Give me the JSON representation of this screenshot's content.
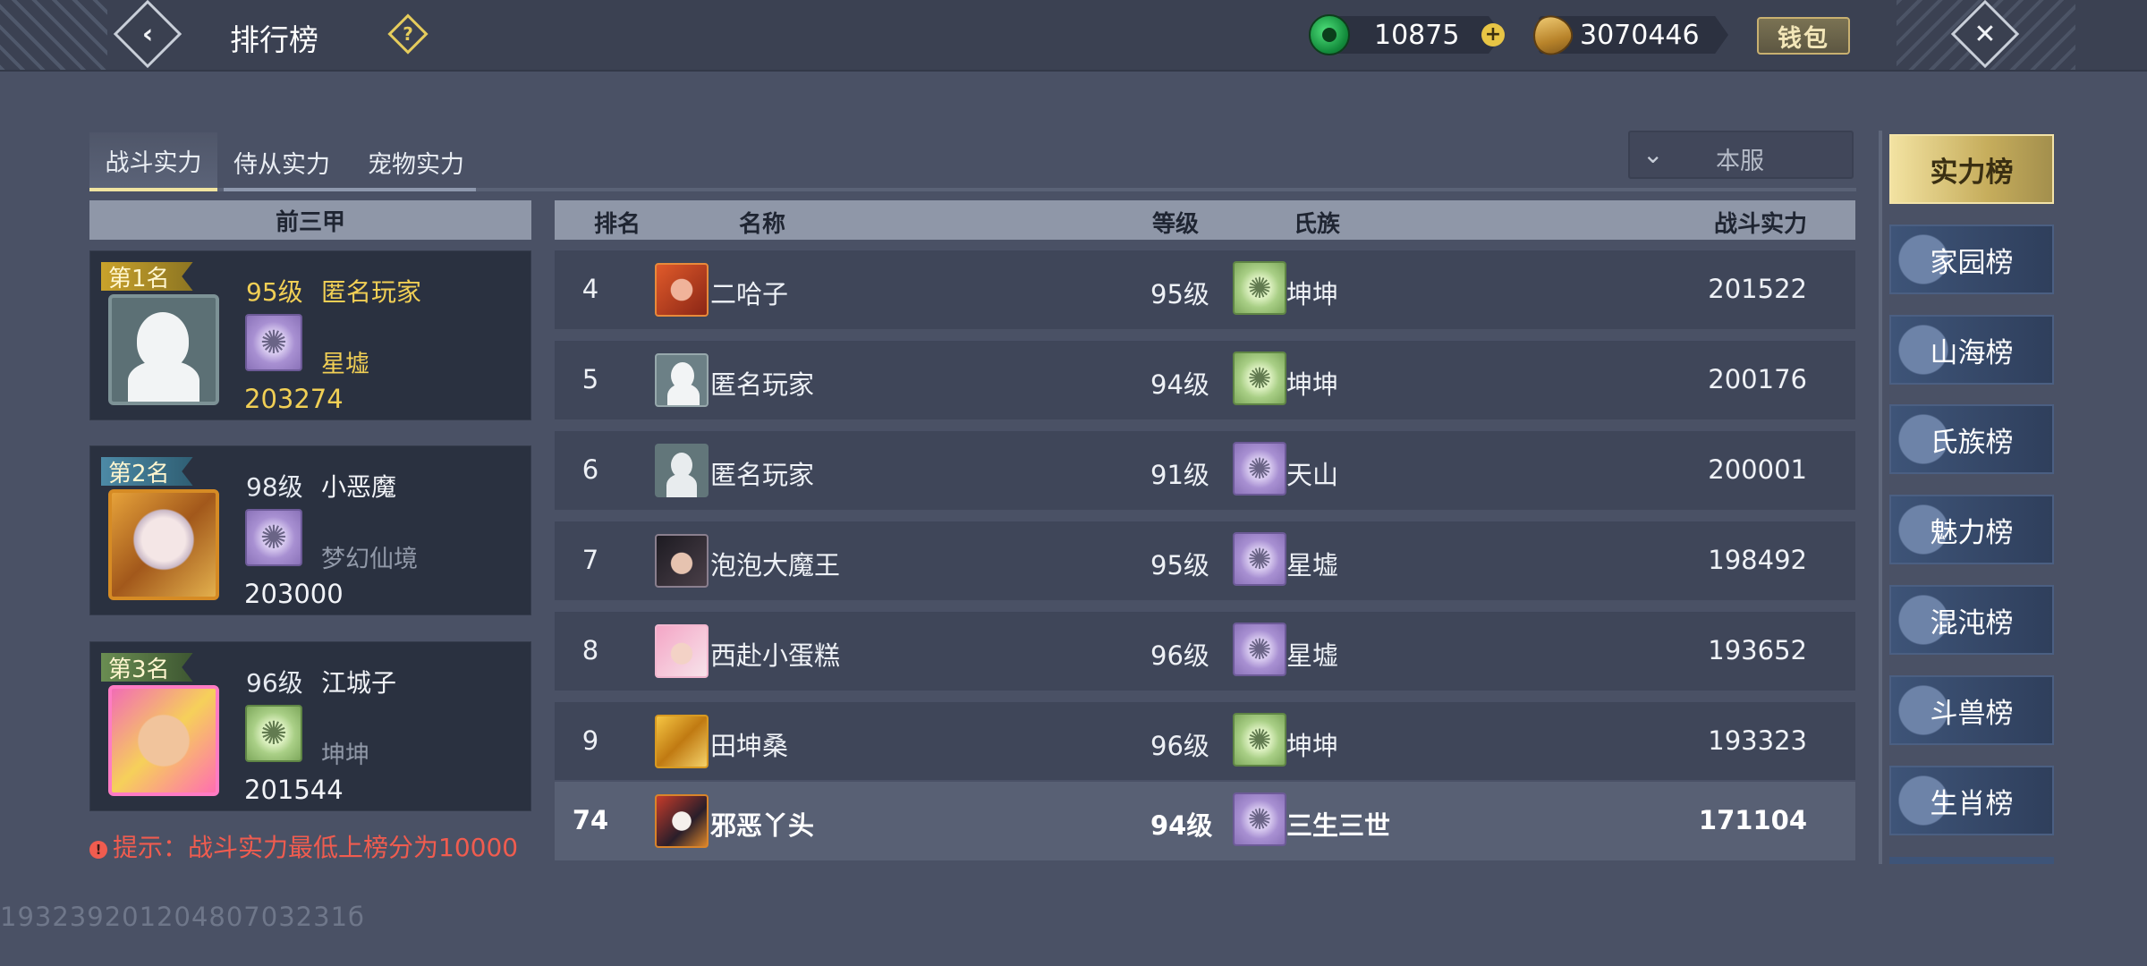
{
  "header": {
    "title": "排行榜",
    "back_icon": "chevron-left-icon",
    "help_icon": "question-icon",
    "close_icon": "close-icon",
    "jade_amount": "10875",
    "gold_amount": "3070446",
    "wallet_label": "钱包"
  },
  "tabs": [
    {
      "label": "战斗实力",
      "active": true
    },
    {
      "label": "侍从实力",
      "active": false
    },
    {
      "label": "宠物实力",
      "active": false
    }
  ],
  "server_select": {
    "value": "本服"
  },
  "top3": {
    "header": "前三甲",
    "entries": [
      {
        "rank_label": "第1名",
        "level": "95级",
        "name": "匿名玩家",
        "clan": "星墟",
        "power": "203274"
      },
      {
        "rank_label": "第2名",
        "level": "98级",
        "name": "小恶魔",
        "clan": "梦幻仙境",
        "power": "203000"
      },
      {
        "rank_label": "第3名",
        "level": "96级",
        "name": "江城子",
        "clan": "坤坤",
        "power": "201544"
      }
    ],
    "hint": "提示：战斗实力最低上榜分为10000"
  },
  "table": {
    "columns": {
      "rank": "排名",
      "name": "名称",
      "level": "等级",
      "clan": "氏族",
      "power": "战斗实力"
    },
    "rows": [
      {
        "rank": "4",
        "name": "二哈子",
        "level": "95级",
        "clan": "坤坤",
        "power": "201522"
      },
      {
        "rank": "5",
        "name": "匿名玩家",
        "level": "94级",
        "clan": "坤坤",
        "power": "200176"
      },
      {
        "rank": "6",
        "name": "匿名玩家",
        "level": "91级",
        "clan": "天山",
        "power": "200001"
      },
      {
        "rank": "7",
        "name": "泡泡大魔王",
        "level": "95级",
        "clan": "星墟",
        "power": "198492"
      },
      {
        "rank": "8",
        "name": "西赴小蛋糕",
        "level": "96级",
        "clan": "星墟",
        "power": "193652"
      },
      {
        "rank": "9",
        "name": "田坤桑",
        "level": "96级",
        "clan": "坤坤",
        "power": "193323"
      }
    ],
    "self_row": {
      "rank": "74",
      "name": "邪恶丫头",
      "level": "94级",
      "clan": "三生三世",
      "power": "171104"
    }
  },
  "boards": [
    {
      "label": "实力榜",
      "active": true
    },
    {
      "label": "家园榜",
      "active": false
    },
    {
      "label": "山海榜",
      "active": false
    },
    {
      "label": "氏族榜",
      "active": false
    },
    {
      "label": "魅力榜",
      "active": false
    },
    {
      "label": "混沌榜",
      "active": false
    },
    {
      "label": "斗兽榜",
      "active": false
    },
    {
      "label": "生肖榜",
      "active": false
    }
  ],
  "uid_text": "19323920120480703231б",
  "colors": {
    "background": "#4a5165",
    "header_bar": "#8f97a8",
    "gold_text": "#f1cf55",
    "hint_red": "#f05c4f",
    "active_board": "#c6ad5c"
  }
}
